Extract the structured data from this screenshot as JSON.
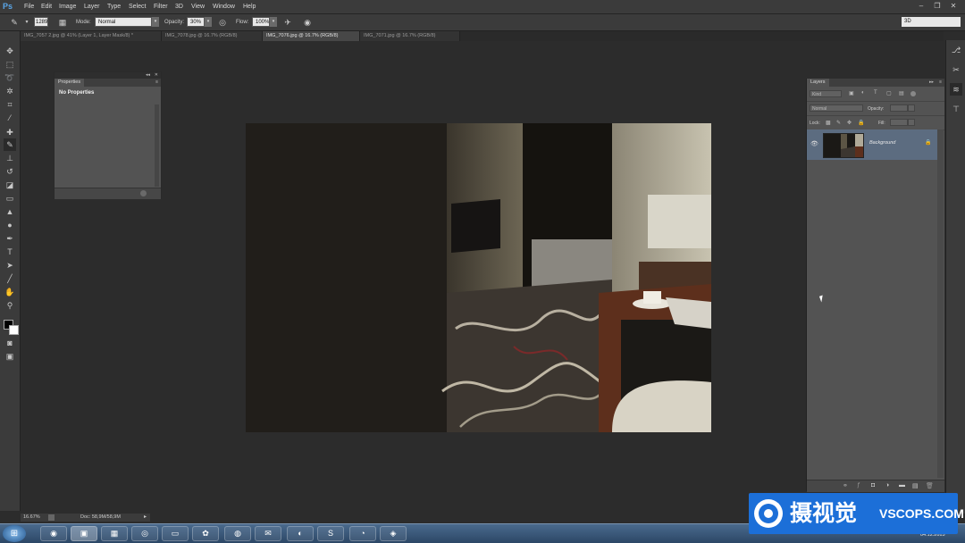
{
  "app": {
    "logo": "Ps"
  },
  "menu": [
    "File",
    "Edit",
    "Image",
    "Layer",
    "Type",
    "Select",
    "Filter",
    "3D",
    "View",
    "Window",
    "Help"
  ],
  "window_controls": {
    "minimize": "–",
    "restore": "❐",
    "close": "✕"
  },
  "options_bar": {
    "brush_size": "1289",
    "mode_label": "Mode:",
    "mode_value": "Normal",
    "opacity_label": "Opacity:",
    "opacity_value": "30%",
    "flow_label": "Flow:",
    "flow_value": "100%",
    "workspace": "3D"
  },
  "tabs": [
    {
      "label": "IMG_7057 2.jpg @ 41% (Layer 1, Layer Mask/8) *",
      "active": false
    },
    {
      "label": "IMG_7078.jpg @ 16.7% (RGB/8)",
      "active": false
    },
    {
      "label": "IMG_7076.jpg @ 16.7% (RGB/8)",
      "active": true
    },
    {
      "label": "IMG_7071.jpg @ 16.7% (RGB/8)",
      "active": false
    }
  ],
  "properties": {
    "tab": "Properties",
    "content": "No Properties"
  },
  "layers": {
    "tab": "Layers",
    "kind": "Kind",
    "blend": "Normal",
    "opacity_label": "Opacity:",
    "lock_label": "Lock:",
    "fill_label": "Fill:",
    "layer_name": "Background"
  },
  "status": {
    "zoom": "16.67%",
    "doc": "Doc: 58,9M/58,9M"
  },
  "taskbar": {
    "date": "04.12.2015"
  },
  "watermark": {
    "cn": "摄视觉",
    "en": "VSCOPS.COM"
  },
  "colors": {
    "panel": "#535353",
    "chrome": "#3b3b3b",
    "selection": "#5c6c80",
    "watermark": "#1c6fd8"
  }
}
